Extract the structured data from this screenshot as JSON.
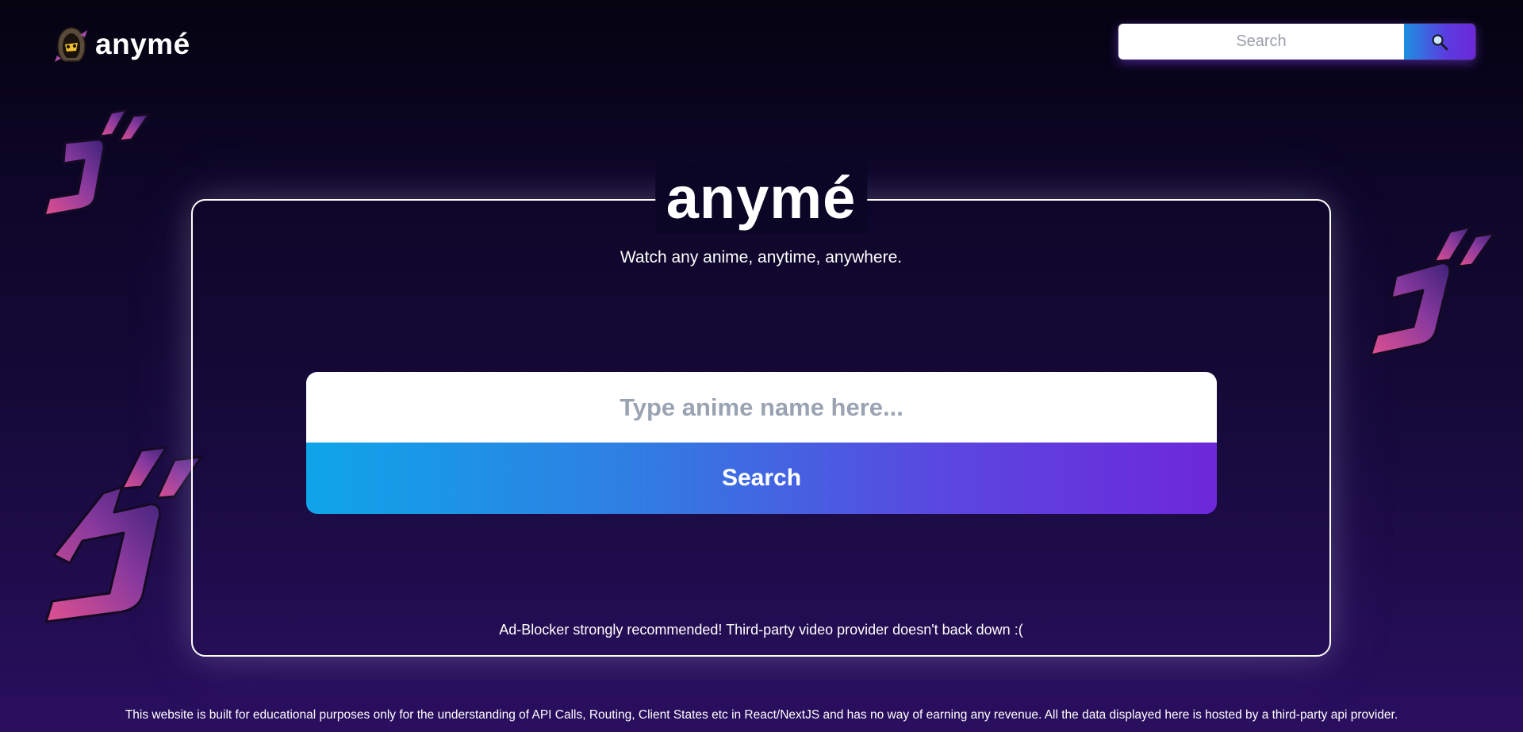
{
  "header": {
    "brand_name": "anymé",
    "logo_icon": "hooded-anime-character-icon",
    "search_placeholder": "Search",
    "search_button_icon": "magnifier-icon"
  },
  "hero": {
    "title": "anymé",
    "tagline": "Watch any anime, anytime, anywhere.",
    "search_placeholder": "Type anime name here...",
    "search_button_label": "Search",
    "adblock_note": "Ad-Blocker strongly recommended! Third-party video provider doesn't back down :("
  },
  "footer": {
    "disclaimer": "This website is built for educational purposes only for the understanding of API Calls, Routing, Client States etc in React/NextJS and has no way of earning any revenue. All the data displayed here is hosted by a third-party api provider."
  },
  "decorations": {
    "icon": "menacing-go-glyph-icon",
    "count": 3
  },
  "colors": {
    "accent_blue": "#0ea5e9",
    "accent_purple": "#6d28d9",
    "background_top": "#050310",
    "background_bottom": "#2a0f5f",
    "glyph_pink": "#e0508f"
  }
}
